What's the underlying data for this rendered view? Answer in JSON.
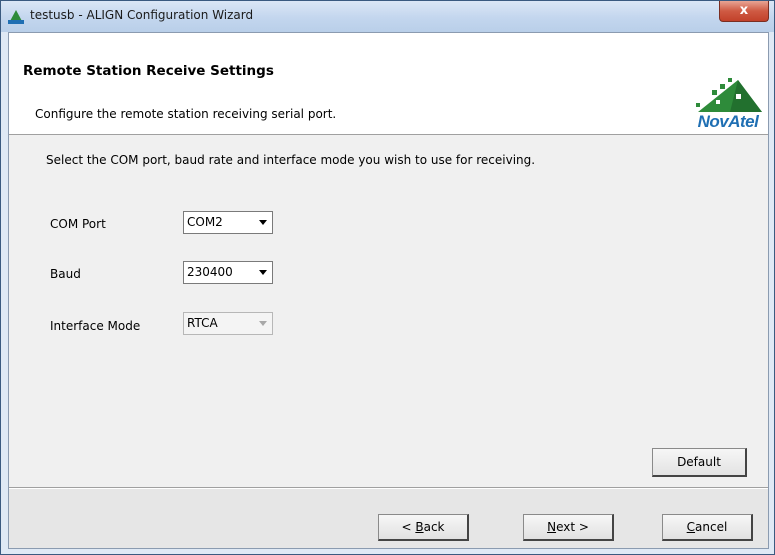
{
  "window": {
    "title": "testusb - ALIGN Configuration Wizard",
    "close_glyph": "x"
  },
  "header": {
    "title": "Remote Station Receive Settings",
    "subtitle": "Configure the remote station receiving serial port.",
    "logo_text": "NovAtel"
  },
  "instruction": "Select the COM port, baud rate and interface mode you wish to use for receiving.",
  "fields": {
    "com_port": {
      "label": "COM Port",
      "value": "COM2"
    },
    "baud": {
      "label": "Baud",
      "value": "230400"
    },
    "interface_mode": {
      "label": "Interface Mode",
      "value": "RTCA"
    }
  },
  "buttons": {
    "default": "Default",
    "back_prefix": "< ",
    "back_key": "B",
    "back_rest": "ack",
    "next_key": "N",
    "next_rest": "ext >",
    "cancel_key": "C",
    "cancel_rest": "ancel"
  },
  "colors": {
    "logo_green": "#2e8b3a",
    "logo_blue": "#1f6fb3",
    "close_red": "#c2412a"
  }
}
